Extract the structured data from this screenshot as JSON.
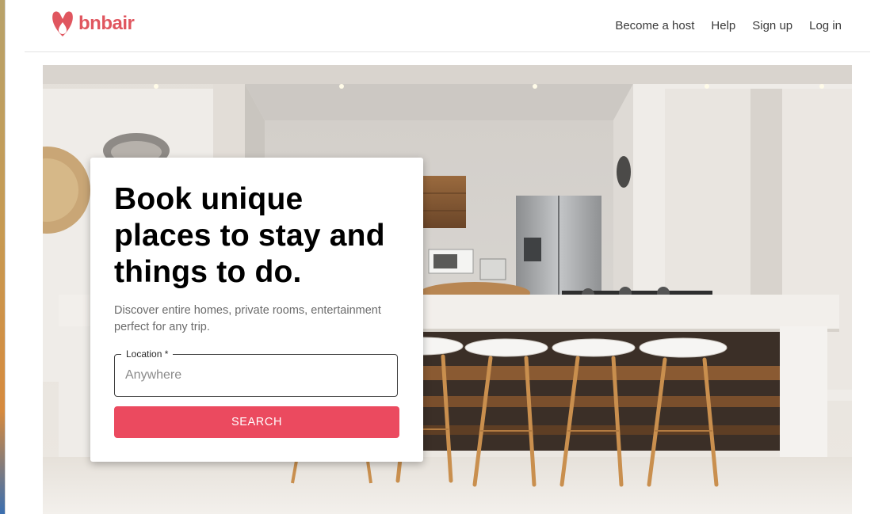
{
  "brand": {
    "name": "bnbair",
    "color": "#e0565f"
  },
  "nav": {
    "items": [
      {
        "label": "Become a host"
      },
      {
        "label": "Help"
      },
      {
        "label": "Sign up"
      },
      {
        "label": "Log in"
      }
    ]
  },
  "hero": {
    "title": "Book unique places to stay and things to do.",
    "subtitle": "Discover entire homes, private rooms, entertainment perfect for any trip.",
    "location_field": {
      "label": "Location *",
      "placeholder": "Anywhere",
      "value": ""
    },
    "search_label": "SEARCH",
    "accent_color": "#eb4a5f"
  }
}
